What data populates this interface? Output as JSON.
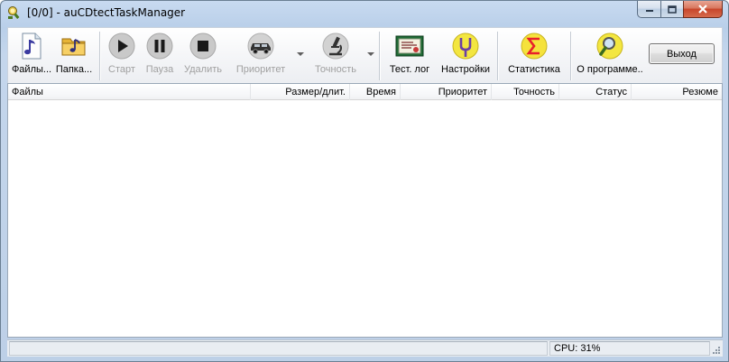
{
  "window": {
    "title": "[0/0] - auCDtectTaskManager"
  },
  "toolbar": {
    "files_label": "Файлы...",
    "folder_label": "Папка...",
    "start_label": "Старт",
    "pause_label": "Пауза",
    "delete_label": "Удалить",
    "priority_label": "Приоритет",
    "accuracy_label": "Точность",
    "testlog_label": "Тест. лог",
    "settings_label": "Настройки",
    "statistics_label": "Статистика",
    "about_label": "О программе..",
    "exit_label": "Выход"
  },
  "table": {
    "columns": [
      "Файлы",
      "Размер/длит.",
      "Время",
      "Приоритет",
      "Точность",
      "Статус",
      "Резюме"
    ],
    "rows": []
  },
  "statusbar": {
    "cpu": "CPU: 31%"
  },
  "colors": {
    "title_bar": "#c8daf0",
    "close_button": "#c7452a",
    "sigma_icon": "#e8202a"
  }
}
